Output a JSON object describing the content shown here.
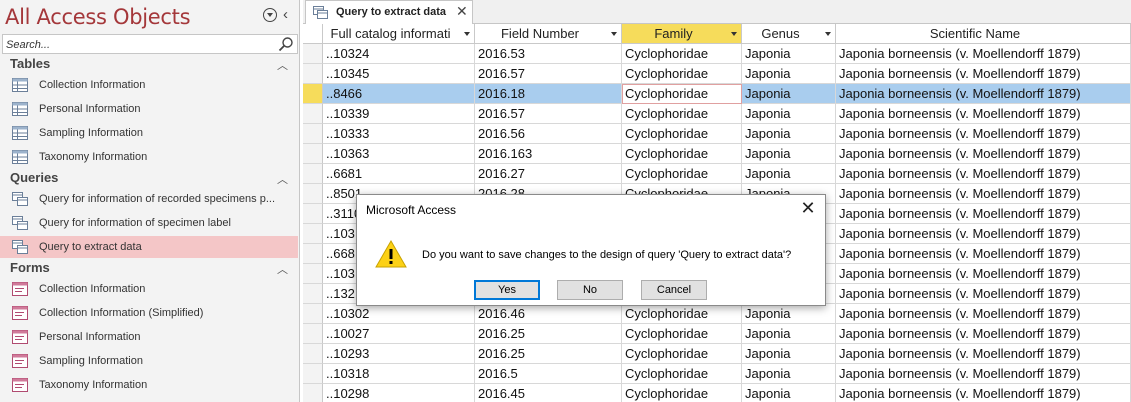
{
  "nav": {
    "title": "All Access Objects",
    "search_placeholder": "Search...",
    "groups": [
      {
        "label": "Tables",
        "items": [
          "Collection Information",
          "Personal Information",
          "Sampling Information",
          "Taxonomy Information"
        ]
      },
      {
        "label": "Queries",
        "items": [
          "Query for information of recorded specimens p...",
          "Query for information of specimen label",
          "Query to extract data"
        ]
      },
      {
        "label": "Forms",
        "items": [
          "Collection Information",
          "Collection Information (Simplified)",
          "Personal Information",
          "Sampling Information",
          "Taxonomy Information"
        ]
      }
    ],
    "selected_item": "Query to extract data"
  },
  "tab": {
    "label": "Query to extract data",
    "close_glyph": "✕"
  },
  "datasheet": {
    "columns": [
      "Full catalog informati",
      "Field Number",
      "Family",
      "Genus",
      "Scientific Name"
    ],
    "selected_column": "Family",
    "active_row": 2,
    "rows": [
      [
        "..10324",
        "2016.53",
        "Cyclophoridae",
        "Japonia",
        "Japonia borneensis (v. Moellendorff 1879)"
      ],
      [
        "..10345",
        "2016.57",
        "Cyclophoridae",
        "Japonia",
        "Japonia borneensis (v. Moellendorff 1879)"
      ],
      [
        "..8466",
        "2016.18",
        "Cyclophoridae",
        "Japonia",
        "Japonia borneensis (v. Moellendorff 1879)"
      ],
      [
        "..10339",
        "2016.57",
        "Cyclophoridae",
        "Japonia",
        "Japonia borneensis (v. Moellendorff 1879)"
      ],
      [
        "..10333",
        "2016.56",
        "Cyclophoridae",
        "Japonia",
        "Japonia borneensis (v. Moellendorff 1879)"
      ],
      [
        "..10363",
        "2016.163",
        "Cyclophoridae",
        "Japonia",
        "Japonia borneensis (v. Moellendorff 1879)"
      ],
      [
        "..6681",
        "2016.27",
        "Cyclophoridae",
        "Japonia",
        "Japonia borneensis (v. Moellendorff 1879)"
      ],
      [
        "..8501",
        "2016.28",
        "Cyclophoridae",
        "Japonia",
        "Japonia borneensis (v. Moellendorff 1879)"
      ],
      [
        "..3110",
        "",
        "",
        "",
        "Japonia borneensis (v. Moellendorff 1879)"
      ],
      [
        "..103",
        "",
        "",
        "",
        "Japonia borneensis (v. Moellendorff 1879)"
      ],
      [
        "..668",
        "",
        "",
        "",
        "Japonia borneensis (v. Moellendorff 1879)"
      ],
      [
        "..103",
        "",
        "",
        "",
        "Japonia borneensis (v. Moellendorff 1879)"
      ],
      [
        "..132",
        "",
        "",
        "",
        "Japonia borneensis (v. Moellendorff 1879)"
      ],
      [
        "..10302",
        "2016.46",
        "Cyclophoridae",
        "Japonia",
        "Japonia borneensis (v. Moellendorff 1879)"
      ],
      [
        "..10027",
        "2016.25",
        "Cyclophoridae",
        "Japonia",
        "Japonia borneensis (v. Moellendorff 1879)"
      ],
      [
        "..10293",
        "2016.25",
        "Cyclophoridae",
        "Japonia",
        "Japonia borneensis (v. Moellendorff 1879)"
      ],
      [
        "..10318",
        "2016.5",
        "Cyclophoridae",
        "Japonia",
        "Japonia borneensis (v. Moellendorff 1879)"
      ],
      [
        "..10298",
        "2016.45",
        "Cyclophoridae",
        "Japonia",
        "Japonia borneensis (v. Moellendorff 1879)"
      ]
    ]
  },
  "dialog": {
    "title": "Microsoft Access",
    "message": "Do you want to save changes to the design of query 'Query to extract data'?",
    "icon": "warning-icon",
    "buttons": {
      "yes": "Yes",
      "no": "No",
      "cancel": "Cancel"
    },
    "close_glyph": "✕"
  },
  "colors": {
    "nav_title": "#a4373a",
    "selected_nav_item": "#f4c6c7",
    "selected_column_header": "#f6dc5b",
    "active_row": "#a9cdee",
    "default_button_border": "#0078d7"
  }
}
